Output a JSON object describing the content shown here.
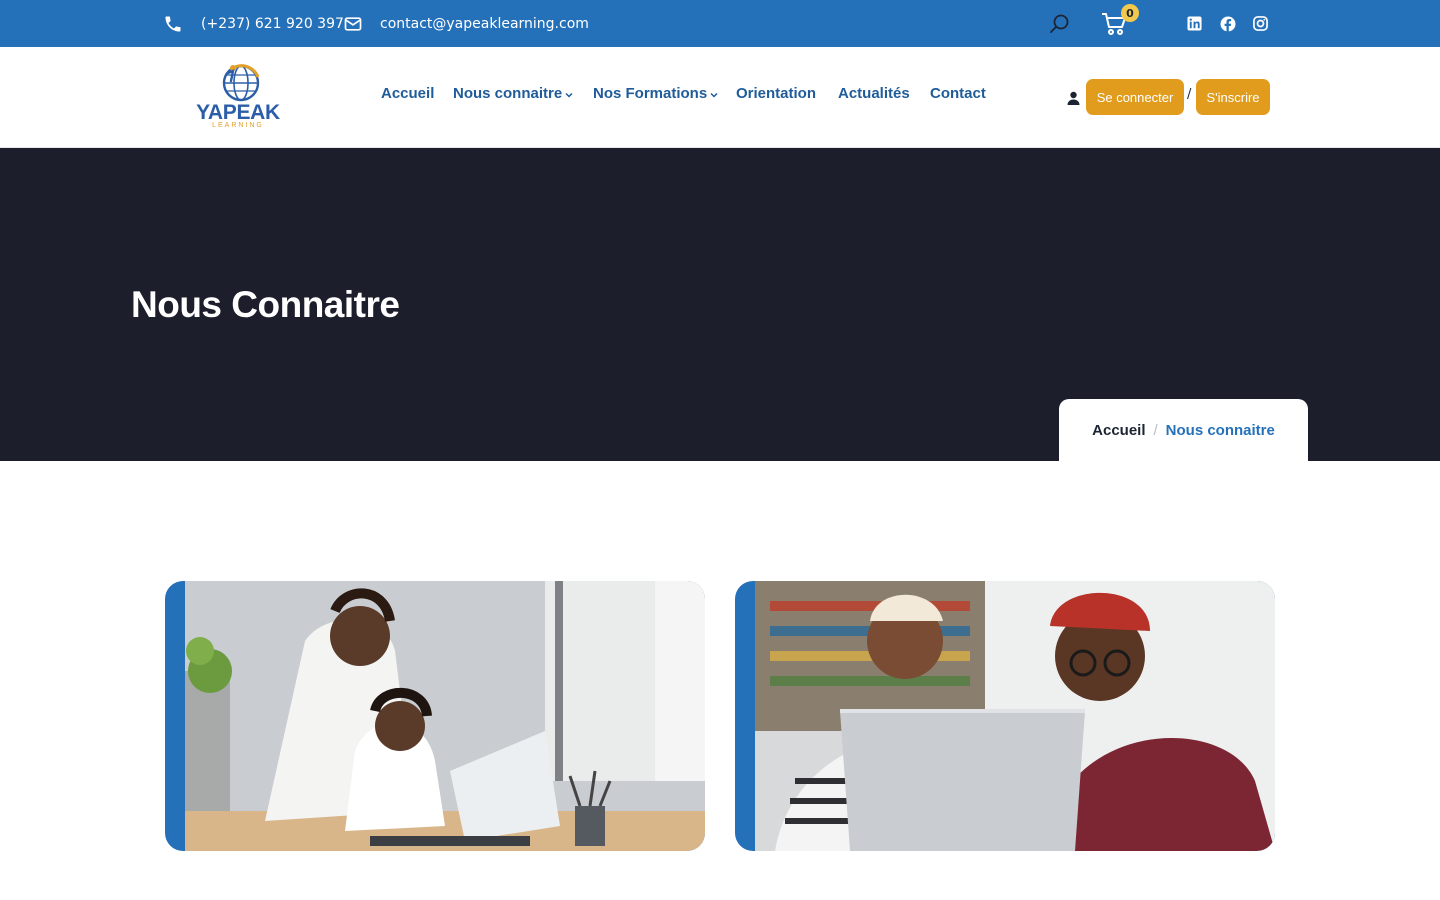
{
  "topbar": {
    "phone": "(+237) 621 920 397",
    "email": "contact@yapeaklearning.com",
    "cart_count": "0",
    "social": [
      "linkedin-icon",
      "facebook-icon",
      "instagram-icon"
    ]
  },
  "brand": {
    "name": "YAPEAK",
    "tagline": "LEARNING",
    "colors": {
      "primary": "#2571b9",
      "accent": "#e29c1d",
      "dark": "#1c1e2b"
    }
  },
  "nav": {
    "items": [
      {
        "label": "Accueil",
        "dropdown": false
      },
      {
        "label": "Nous connaitre",
        "dropdown": true
      },
      {
        "label": "Nos Formations",
        "dropdown": true
      },
      {
        "label": "Orientation",
        "dropdown": false
      },
      {
        "label": "Actualités",
        "dropdown": false
      },
      {
        "label": "Contact",
        "dropdown": false
      }
    ],
    "login_label": "Se connecter",
    "separator": "/",
    "signup_label": "S'inscrire"
  },
  "hero": {
    "title": "Nous Connaitre",
    "breadcrumb": {
      "home": "Accueil",
      "separator": "/",
      "current": "Nous connaitre"
    }
  }
}
